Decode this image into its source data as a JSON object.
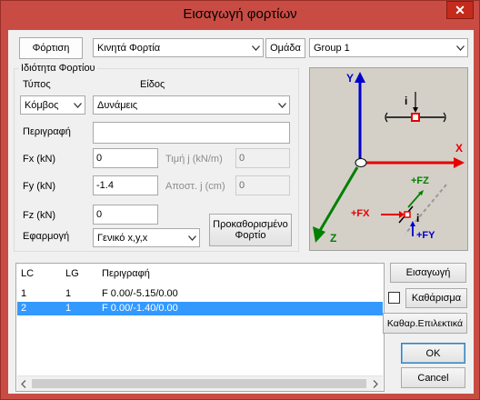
{
  "window": {
    "title": "Εισαγωγή φορτίων",
    "close_label": "✕"
  },
  "top": {
    "tab_label": "Φόρτιση",
    "load_type": "Κινητά Φορτία",
    "group_label": "Ομάδα",
    "group_value": "Group 1"
  },
  "property": {
    "legend": "Ιδιότητα Φορτίου",
    "type_label": "Τύπος",
    "kind_label": "Είδος",
    "type_value": "Κόμβος",
    "kind_value": "Δυνάμεις"
  },
  "form": {
    "description_label": "Περιγραφή",
    "description_value": "",
    "fx_label": "Fx (kN)",
    "fx_value": "0",
    "fy_label": "Fy (kN)",
    "fy_value": "-1.4",
    "fz_label": "Fz (kN)",
    "fz_value": "0",
    "value_j_label": "Τιμή j (kN/m)",
    "value_j_value": "0",
    "distance_j_label": "Αποστ. j (cm)",
    "distance_j_value": "0",
    "apply_label": "Εφαρμογή",
    "apply_value": "Γενικό x,y,x",
    "predefined_label": "Προκαθορισμένο Φορτίο"
  },
  "diagram": {
    "axis_y": "Y",
    "axis_x": "X",
    "axis_z": "Z",
    "node_label": "i",
    "fx_arrow": "+FX",
    "fy_arrow": "+FY",
    "fz_arrow": "+FZ"
  },
  "table": {
    "headers": {
      "lc": "LC",
      "lg": "LG",
      "desc": "Περιγραφή"
    },
    "rows": [
      {
        "lc": "1",
        "lg": "1",
        "desc": "F  0.00/-5.15/0.00"
      },
      {
        "lc": "2",
        "lg": "1",
        "desc": "F  0.00/-1.40/0.00"
      }
    ],
    "selected_row": 2
  },
  "actions": {
    "insert": "Εισαγωγή",
    "clear": "Καθάρισμα",
    "clear_selected": "Καθαρ.Επιλεκτικά",
    "ok": "OK",
    "cancel": "Cancel"
  },
  "colors": {
    "title_bar": "#c94c44",
    "selection": "#3399ff",
    "axis_x": "#e60000",
    "axis_y": "#0000cc",
    "axis_z": "#008000"
  }
}
